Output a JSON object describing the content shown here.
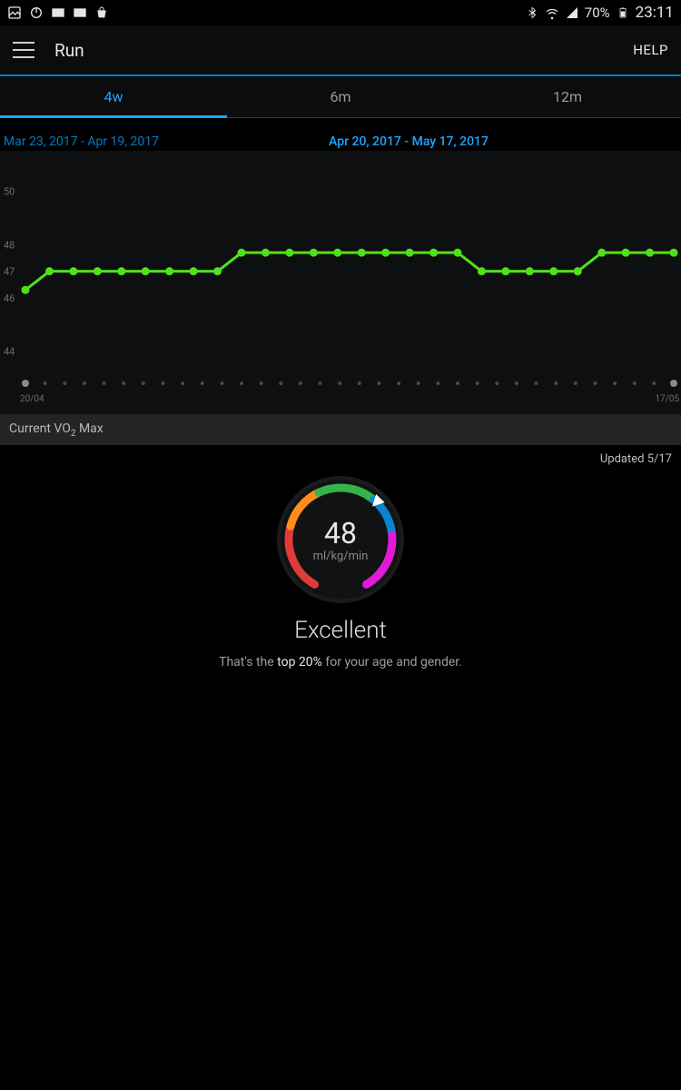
{
  "status_bar": {
    "battery_pct": "70%",
    "clock": "23:11"
  },
  "appbar": {
    "title": "Run",
    "help_label": "HELP"
  },
  "tabs": {
    "items": [
      "4w",
      "6m",
      "12m"
    ],
    "active_index": 0
  },
  "date_ranges": {
    "prev": "Mar 23, 2017 - Apr 19, 2017",
    "current": "Apr 20, 2017 - May 17, 2017"
  },
  "chart_data": {
    "type": "line",
    "title": "",
    "xlabel": "",
    "ylabel": "",
    "y_ticks": [
      44,
      46,
      47,
      48,
      50
    ],
    "ylim": [
      43,
      50.5
    ],
    "x_start_label": "20/04",
    "x_end_label": "17/05",
    "x": [
      1,
      2,
      3,
      4,
      5,
      6,
      7,
      8,
      9,
      10,
      11,
      12,
      13,
      14,
      15,
      16,
      17,
      18,
      19,
      20,
      21,
      22,
      23,
      24,
      25,
      26,
      27,
      28
    ],
    "values": [
      46.3,
      47,
      47,
      47,
      47,
      47,
      47,
      47,
      47,
      47.7,
      47.7,
      47.7,
      47.7,
      47.7,
      47.7,
      47.7,
      47.7,
      47.7,
      47.7,
      47,
      47,
      47,
      47,
      47,
      47.7,
      47.7,
      47.7,
      47.7
    ],
    "series_color": "#4ee21b"
  },
  "vo2_section": {
    "header_html_label": "Current VO",
    "header_sub": "2",
    "header_tail": " Max",
    "updated_label": "Updated 5/17",
    "value": "48",
    "unit": "ml/kg/min",
    "rating": "Excellent",
    "subtext_prefix": "That's the ",
    "subtext_highlight": "top  20%",
    "subtext_suffix": " for your age and gender.",
    "gauge_segments": [
      {
        "color": "#e03a3a"
      },
      {
        "color": "#ff8c1a"
      },
      {
        "color": "#33b54a"
      },
      {
        "color": "#0a84d1"
      },
      {
        "color": "#e01bd7"
      }
    ]
  }
}
